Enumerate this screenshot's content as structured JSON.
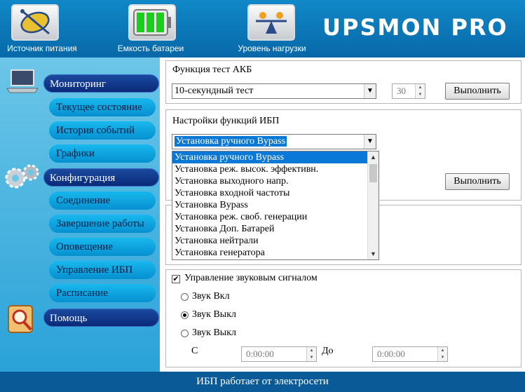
{
  "topbar": {
    "buttons": [
      {
        "label": "Источник питания",
        "icon": "plug-icon"
      },
      {
        "label": "Емкость батареи",
        "icon": "battery-icon"
      },
      {
        "label": "Уровень нагрузки",
        "icon": "scale-icon"
      }
    ],
    "logo": "UPSMON PRO"
  },
  "sidebar": {
    "monitoring": "Мониторинг",
    "current_state": "Текущее состояние",
    "event_history": "История событий",
    "graphs": "Графики",
    "configuration": "Конфигурация",
    "connection": "Соединение",
    "shutdown": "Завершение работы",
    "notification": "Оповещение",
    "ups_control": "Управление ИБП",
    "schedule": "Расписание",
    "help": "Помощь"
  },
  "battery_test": {
    "title": "Функция тест АКБ",
    "selected": "10-секундный тест",
    "duration_value": "30",
    "run_label": "Выполнить"
  },
  "ups_functions": {
    "title": "Настройки функций ИБП",
    "selected": "Установка ручного Bypass",
    "run_label": "Выполнить",
    "options": [
      "Установка ручного Bypass",
      "Установка реж. высок. эффективн.",
      "Установка выходного напр.",
      "Установка входной частоты",
      "Установка Bypass",
      "Установка реж. своб. генерации",
      "Установка Доп. Батарей",
      "Установка нейтрали",
      "Установка генератора"
    ]
  },
  "sound": {
    "title": "Управление звуковым сигналом",
    "checked": true,
    "options": [
      "Звук Вкл",
      "Звук Выкл",
      "Звук Выкл"
    ],
    "selected_index": 1,
    "from_label": "С",
    "to_label": "До",
    "from_time": "0:00:00",
    "to_time": "0:00:00"
  },
  "status": "ИБП работает от электросети",
  "colors": {
    "nav_main": "#0a2a78",
    "nav_sub": "#0690d0",
    "selection": "#0a78d7"
  }
}
